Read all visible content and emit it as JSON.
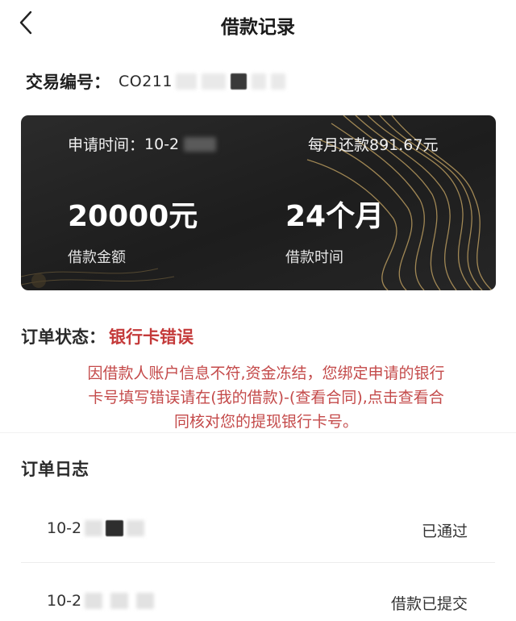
{
  "header": {
    "title": "借款记录",
    "back_icon": "chevron-left-icon"
  },
  "transaction": {
    "label": "交易编号：",
    "value_visible": "CO211"
  },
  "loan_card": {
    "apply_time_label": "申请时间：",
    "apply_time_visible": "10-2",
    "monthly_repayment": "每月还款891.67元",
    "amount": "20000元",
    "amount_label": "借款金额",
    "term": "24个月",
    "term_label": "借款时间",
    "accent_color": "#b89a5e"
  },
  "order_status": {
    "label": "订单状态：",
    "value": "银行卡错误",
    "value_color": "#c43a3a",
    "note_lines": [
      "因借款人账户信息不符,资金冻结，您绑定申请的银行",
      "卡号填写错误请在(我的借款)-(查看合同),点击查看合",
      "同核对您的提现银行卡号。"
    ]
  },
  "order_log": {
    "title": "订单日志",
    "entries": [
      {
        "date_visible": "10-2",
        "status": "已通过"
      },
      {
        "date_visible": "10-2",
        "status": "借款已提交"
      }
    ]
  }
}
